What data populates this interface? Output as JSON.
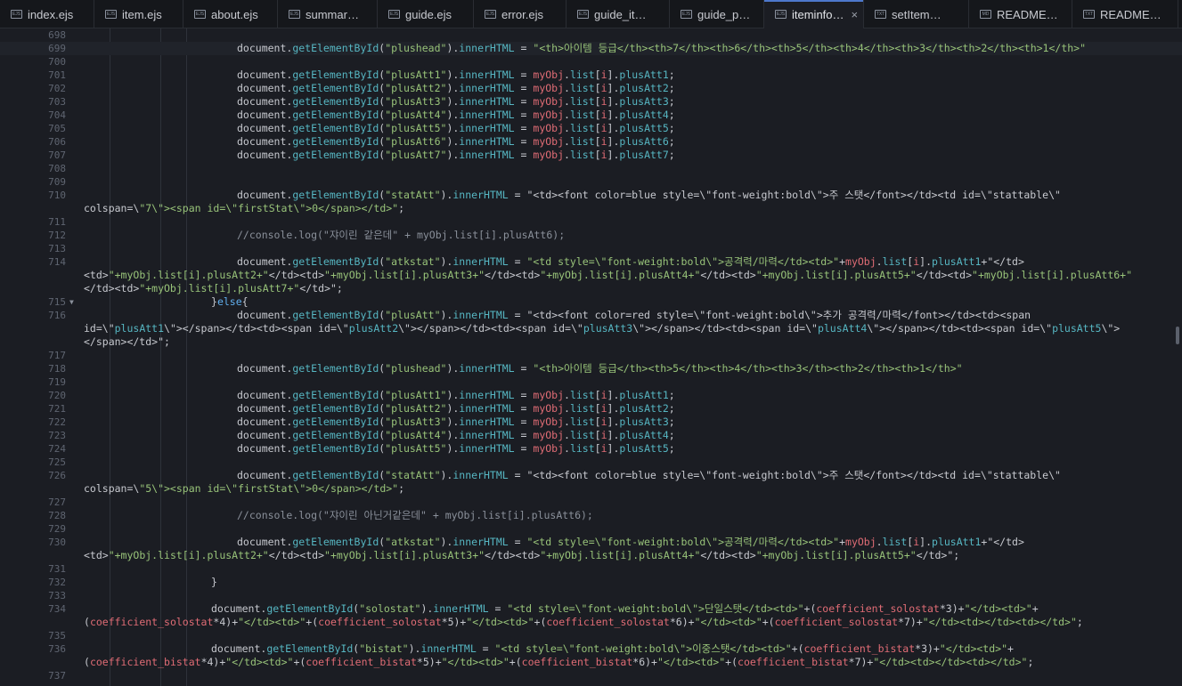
{
  "tabs": [
    {
      "label": "index.ejs",
      "icon": "ejs-file-icon",
      "active": false
    },
    {
      "label": "item.ejs",
      "icon": "ejs-file-icon",
      "active": false
    },
    {
      "label": "about.ejs",
      "icon": "ejs-file-icon",
      "active": false
    },
    {
      "label": "summar…",
      "icon": "ejs-file-icon",
      "active": false
    },
    {
      "label": "guide.ejs",
      "icon": "ejs-file-icon",
      "active": false
    },
    {
      "label": "error.ejs",
      "icon": "ejs-file-icon",
      "active": false
    },
    {
      "label": "guide_it…",
      "icon": "ejs-file-icon",
      "active": false
    },
    {
      "label": "guide_p…",
      "icon": "ejs-file-icon",
      "active": false
    },
    {
      "label": "iteminfo…",
      "icon": "ejs-file-icon",
      "active": true
    },
    {
      "label": "setItem…",
      "icon": "txt-file-icon",
      "active": false
    },
    {
      "label": "README…",
      "icon": "md-file-icon",
      "active": false
    },
    {
      "label": "README…",
      "icon": "txt-file-icon",
      "active": false
    }
  ],
  "tab_close_glyph": "×",
  "colors": {
    "accent": "#4d78cc",
    "string": "#98c379",
    "variable": "#e06c75",
    "function": "#56b6c2",
    "keyword": "#61afef",
    "comment": "#8a909a"
  },
  "lines": [
    {
      "n": "698",
      "indent": 0,
      "text": ""
    },
    {
      "n": "699",
      "indent": 3,
      "text": "document.getElementById(\"plushead\").innerHTML = \"<th>아이템 등급</th><th>7</th><th>6</th><th>5</th><th>4</th><th>3</th><th>2</th><th>1</th>\"",
      "current": true
    },
    {
      "n": "700",
      "indent": 0,
      "text": ""
    },
    {
      "n": "701",
      "indent": 3,
      "text": "document.getElementById(\"plusAtt1\").innerHTML = myObj.list[i].plusAtt1;"
    },
    {
      "n": "702",
      "indent": 3,
      "text": "document.getElementById(\"plusAtt2\").innerHTML = myObj.list[i].plusAtt2;"
    },
    {
      "n": "703",
      "indent": 3,
      "text": "document.getElementById(\"plusAtt3\").innerHTML = myObj.list[i].plusAtt3;"
    },
    {
      "n": "704",
      "indent": 3,
      "text": "document.getElementById(\"plusAtt4\").innerHTML = myObj.list[i].plusAtt4;"
    },
    {
      "n": "705",
      "indent": 3,
      "text": "document.getElementById(\"plusAtt5\").innerHTML = myObj.list[i].plusAtt5;"
    },
    {
      "n": "706",
      "indent": 3,
      "text": "document.getElementById(\"plusAtt6\").innerHTML = myObj.list[i].plusAtt6;"
    },
    {
      "n": "707",
      "indent": 3,
      "text": "document.getElementById(\"plusAtt7\").innerHTML = myObj.list[i].plusAtt7;"
    },
    {
      "n": "708",
      "indent": 0,
      "text": ""
    },
    {
      "n": "709",
      "indent": 0,
      "text": ""
    },
    {
      "n": "710",
      "indent": 3,
      "text": "document.getElementById(\"statAtt\").innerHTML = \"<td><font color=blue style=\\\"font-weight:bold\\\">주 스탯</font></td><td id=\\\"stattable\\\""
    },
    {
      "n": "",
      "indent": 0,
      "text": "colspan=\\\"7\\\"><span id=\\\"firstStat\\\">0</span></td>\";"
    },
    {
      "n": "711",
      "indent": 0,
      "text": ""
    },
    {
      "n": "712",
      "indent": 3,
      "text": "//console.log(\"쟈이린 같은데\" + myObj.list[i].plusAtt6);",
      "comment": true
    },
    {
      "n": "713",
      "indent": 0,
      "text": ""
    },
    {
      "n": "714",
      "indent": 3,
      "text": "document.getElementById(\"atkstat\").innerHTML = \"<td style=\\\"font-weight:bold\\\">공격력/마력</td><td>\"+myObj.list[i].plusAtt1+\"</td>"
    },
    {
      "n": "",
      "indent": 0,
      "text": "<td>\"+myObj.list[i].plusAtt2+\"</td><td>\"+myObj.list[i].plusAtt3+\"</td><td>\"+myObj.list[i].plusAtt4+\"</td><td>\"+myObj.list[i].plusAtt5+\"</td><td>\"+myObj.list[i].plusAtt6+\""
    },
    {
      "n": "",
      "indent": 0,
      "text": "</td><td>\"+myObj.list[i].plusAtt7+\"</td>\";"
    },
    {
      "n": "715",
      "indent": 2,
      "text": "}else{",
      "fold": true
    },
    {
      "n": "716",
      "indent": 3,
      "text": "document.getElementById(\"plusAtt\").innerHTML = \"<td><font color=red style=\\\"font-weight:bold\\\">추가 공격력/마력</font></td><td><span"
    },
    {
      "n": "",
      "indent": 0,
      "text": "id=\\\"plusAtt1\\\"></span></td><td><span id=\\\"plusAtt2\\\"></span></td><td><span id=\\\"plusAtt3\\\"></span></td><td><span id=\\\"plusAtt4\\\"></span></td><td><span id=\\\"plusAtt5\\\">"
    },
    {
      "n": "",
      "indent": 0,
      "text": "</span></td>\";"
    },
    {
      "n": "717",
      "indent": 0,
      "text": ""
    },
    {
      "n": "718",
      "indent": 3,
      "text": "document.getElementById(\"plushead\").innerHTML = \"<th>아이템 등급</th><th>5</th><th>4</th><th>3</th><th>2</th><th>1</th>\""
    },
    {
      "n": "719",
      "indent": 0,
      "text": ""
    },
    {
      "n": "720",
      "indent": 3,
      "text": "document.getElementById(\"plusAtt1\").innerHTML = myObj.list[i].plusAtt1;"
    },
    {
      "n": "721",
      "indent": 3,
      "text": "document.getElementById(\"plusAtt2\").innerHTML = myObj.list[i].plusAtt2;"
    },
    {
      "n": "722",
      "indent": 3,
      "text": "document.getElementById(\"plusAtt3\").innerHTML = myObj.list[i].plusAtt3;"
    },
    {
      "n": "723",
      "indent": 3,
      "text": "document.getElementById(\"plusAtt4\").innerHTML = myObj.list[i].plusAtt4;"
    },
    {
      "n": "724",
      "indent": 3,
      "text": "document.getElementById(\"plusAtt5\").innerHTML = myObj.list[i].plusAtt5;"
    },
    {
      "n": "725",
      "indent": 0,
      "text": ""
    },
    {
      "n": "726",
      "indent": 3,
      "text": "document.getElementById(\"statAtt\").innerHTML = \"<td><font color=blue style=\\\"font-weight:bold\\\">주 스탯</font></td><td id=\\\"stattable\\\""
    },
    {
      "n": "",
      "indent": 0,
      "text": "colspan=\\\"5\\\"><span id=\\\"firstStat\\\">0</span></td>\";"
    },
    {
      "n": "727",
      "indent": 0,
      "text": ""
    },
    {
      "n": "728",
      "indent": 3,
      "text": "//console.log(\"쟈이린 아닌거같은데\" + myObj.list[i].plusAtt6);",
      "comment": true
    },
    {
      "n": "729",
      "indent": 0,
      "text": ""
    },
    {
      "n": "730",
      "indent": 3,
      "text": "document.getElementById(\"atkstat\").innerHTML = \"<td style=\\\"font-weight:bold\\\">공격력/마력</td><td>\"+myObj.list[i].plusAtt1+\"</td>"
    },
    {
      "n": "",
      "indent": 0,
      "text": "<td>\"+myObj.list[i].plusAtt2+\"</td><td>\"+myObj.list[i].plusAtt3+\"</td><td>\"+myObj.list[i].plusAtt4+\"</td><td>\"+myObj.list[i].plusAtt5+\"</td>\";"
    },
    {
      "n": "731",
      "indent": 0,
      "text": ""
    },
    {
      "n": "732",
      "indent": 2,
      "text": "}"
    },
    {
      "n": "733",
      "indent": 0,
      "text": ""
    },
    {
      "n": "734",
      "indent": 2,
      "text": "document.getElementById(\"solostat\").innerHTML = \"<td style=\\\"font-weight:bold\\\">단일스탯</td><td>\"+(coefficient_solostat*3)+\"</td><td>\"+"
    },
    {
      "n": "",
      "indent": 0,
      "text": "(coefficient_solostat*4)+\"</td><td>\"+(coefficient_solostat*5)+\"</td><td>\"+(coefficient_solostat*6)+\"</td><td>\"+(coefficient_solostat*7)+\"</td><td></td><td></td>\";"
    },
    {
      "n": "735",
      "indent": 0,
      "text": ""
    },
    {
      "n": "736",
      "indent": 2,
      "text": "document.getElementById(\"bistat\").innerHTML = \"<td style=\\\"font-weight:bold\\\">이중스탯</td><td>\"+(coefficient_bistat*3)+\"</td><td>\"+"
    },
    {
      "n": "",
      "indent": 0,
      "text": "(coefficient_bistat*4)+\"</td><td>\"+(coefficient_bistat*5)+\"</td><td>\"+(coefficient_bistat*6)+\"</td><td>\"+(coefficient_bistat*7)+\"</td><td></td><td></td>\";"
    },
    {
      "n": "737",
      "indent": 0,
      "text": ""
    }
  ]
}
